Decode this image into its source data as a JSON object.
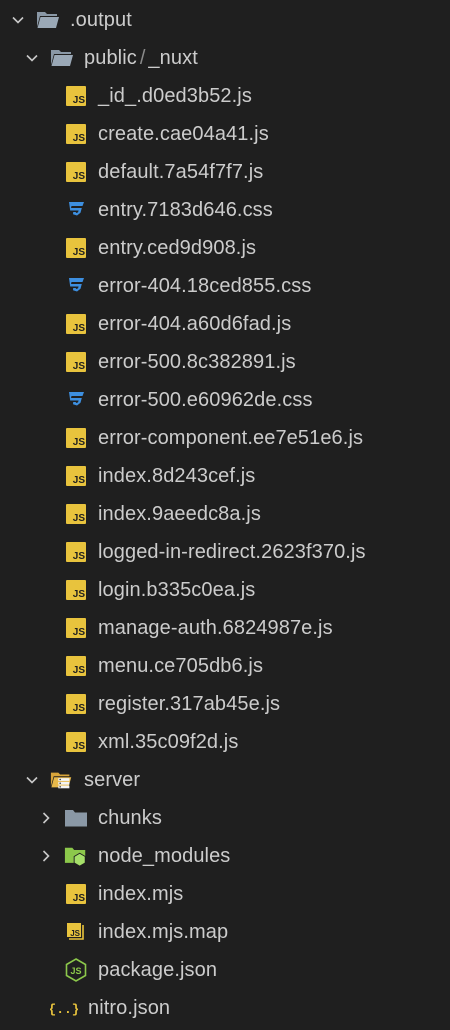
{
  "tree": {
    "root": {
      "label": ".output",
      "public": {
        "label": "public",
        "separator": "/",
        "nuxt_label": "_nuxt",
        "files": [
          {
            "name": "_id_.d0ed3b52.js",
            "type": "js"
          },
          {
            "name": "create.cae04a41.js",
            "type": "js"
          },
          {
            "name": "default.7a54f7f7.js",
            "type": "js"
          },
          {
            "name": "entry.7183d646.css",
            "type": "css"
          },
          {
            "name": "entry.ced9d908.js",
            "type": "js"
          },
          {
            "name": "error-404.18ced855.css",
            "type": "css"
          },
          {
            "name": "error-404.a60d6fad.js",
            "type": "js"
          },
          {
            "name": "error-500.8c382891.js",
            "type": "js"
          },
          {
            "name": "error-500.e60962de.css",
            "type": "css"
          },
          {
            "name": "error-component.ee7e51e6.js",
            "type": "js"
          },
          {
            "name": "index.8d243cef.js",
            "type": "js"
          },
          {
            "name": "index.9aeedc8a.js",
            "type": "js"
          },
          {
            "name": "logged-in-redirect.2623f370.js",
            "type": "js"
          },
          {
            "name": "login.b335c0ea.js",
            "type": "js"
          },
          {
            "name": "manage-auth.6824987e.js",
            "type": "js"
          },
          {
            "name": "menu.ce705db6.js",
            "type": "js"
          },
          {
            "name": "register.317ab45e.js",
            "type": "js"
          },
          {
            "name": "xml.35c09f2d.js",
            "type": "js"
          }
        ]
      },
      "server": {
        "label": "server",
        "chunks_label": "chunks",
        "node_modules_label": "node_modules",
        "index_mjs_label": "index.mjs",
        "index_mjs_map_label": "index.mjs.map",
        "package_json_label": "package.json"
      },
      "nitro_json_label": "nitro.json"
    }
  },
  "icons": {
    "js_text": "JS",
    "json_text": "{..}"
  },
  "colors": {
    "background": "#1f1f1f",
    "text": "#cccccc",
    "js_yellow": "#e8c33d",
    "css_blue": "#3d8fe0",
    "folder_gray": "#8a98a6",
    "node_green": "#8cc84b"
  }
}
